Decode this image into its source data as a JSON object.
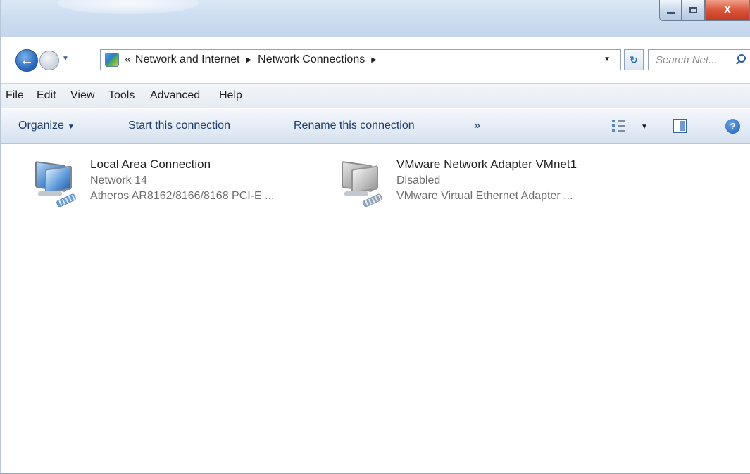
{
  "window": {
    "caption": {
      "minimize": "minimize-icon",
      "maximize": "maximize-icon",
      "close": "X"
    }
  },
  "address": {
    "chevron": "«",
    "crumbs": [
      "Network and Internet",
      "Network Connections"
    ],
    "search_placeholder": "Search Net..."
  },
  "menu": [
    "File",
    "Edit",
    "View",
    "Tools",
    "Advanced",
    "Help"
  ],
  "commands": {
    "organize": "Organize",
    "start": "Start this connection",
    "rename": "Rename this connection",
    "more": "»"
  },
  "connections": [
    {
      "name": "Local Area Connection",
      "status": "Network 14",
      "device": "Atheros AR8162/8166/8168 PCI-E ...",
      "icon": "network-connection-icon"
    },
    {
      "name": "VMware Network Adapter VMnet1",
      "status": "Disabled",
      "device": "VMware Virtual Ethernet Adapter ...",
      "icon": "network-connection-disabled-icon"
    }
  ],
  "colors": {
    "accent": "#2f6db5",
    "command_text": "#1e3c68",
    "secondary_text": "#6d6d6d"
  }
}
